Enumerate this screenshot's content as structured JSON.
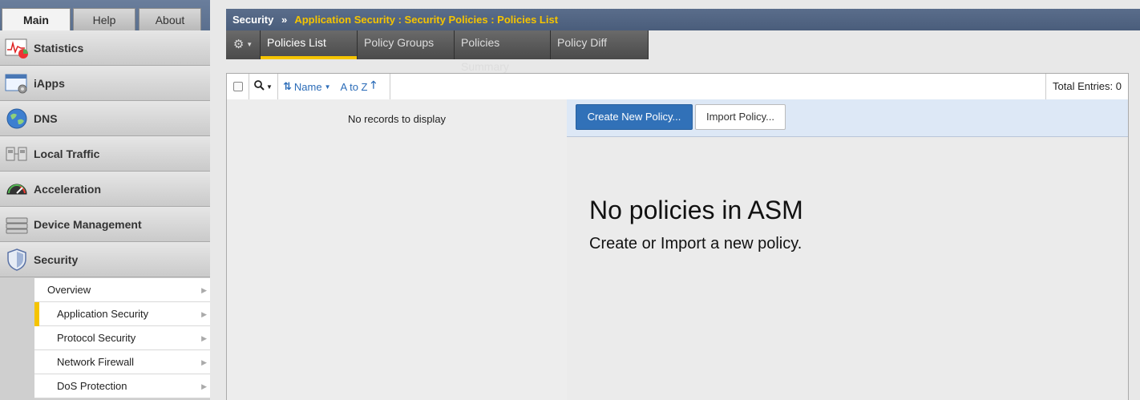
{
  "top_tabs": [
    {
      "label": "Main",
      "active": true
    },
    {
      "label": "Help",
      "active": false
    },
    {
      "label": "About",
      "active": false
    }
  ],
  "nav": [
    {
      "label": "Statistics",
      "icon": "statistics-icon"
    },
    {
      "label": "iApps",
      "icon": "iapps-icon"
    },
    {
      "label": "DNS",
      "icon": "globe-icon"
    },
    {
      "label": "Local Traffic",
      "icon": "local-traffic-icon"
    },
    {
      "label": "Acceleration",
      "icon": "gauge-icon"
    },
    {
      "label": "Device Management",
      "icon": "device-management-icon"
    },
    {
      "label": "Security",
      "icon": "shield-icon"
    }
  ],
  "security_sub": [
    {
      "label": "Overview"
    },
    {
      "label": "Application Security"
    },
    {
      "label": "Protocol Security"
    },
    {
      "label": "Network Firewall"
    },
    {
      "label": "DoS Protection"
    }
  ],
  "header": {
    "section": "Security",
    "separator": "»",
    "path": "Application Security : Security Policies : Policies List"
  },
  "subtabs": [
    {
      "label": "Policies List",
      "active": true
    },
    {
      "label": "Policy Groups",
      "active": false
    },
    {
      "label": "Policies Summary",
      "active": false
    },
    {
      "label": "Policy Diff",
      "active": false
    }
  ],
  "toolbar": {
    "sort_field": "Name",
    "sort_order": "A to Z",
    "total_entries": "Total Entries: 0"
  },
  "list": {
    "empty_text": "No records to display"
  },
  "detail": {
    "create_button": "Create New Policy...",
    "import_button": "Import Policy...",
    "empty_title": "No policies in ASM",
    "empty_subtitle": "Create or Import a new policy."
  },
  "colors": {
    "accent": "#f5c400",
    "primary_button": "#3171b8",
    "header": "#4a5d7b"
  }
}
